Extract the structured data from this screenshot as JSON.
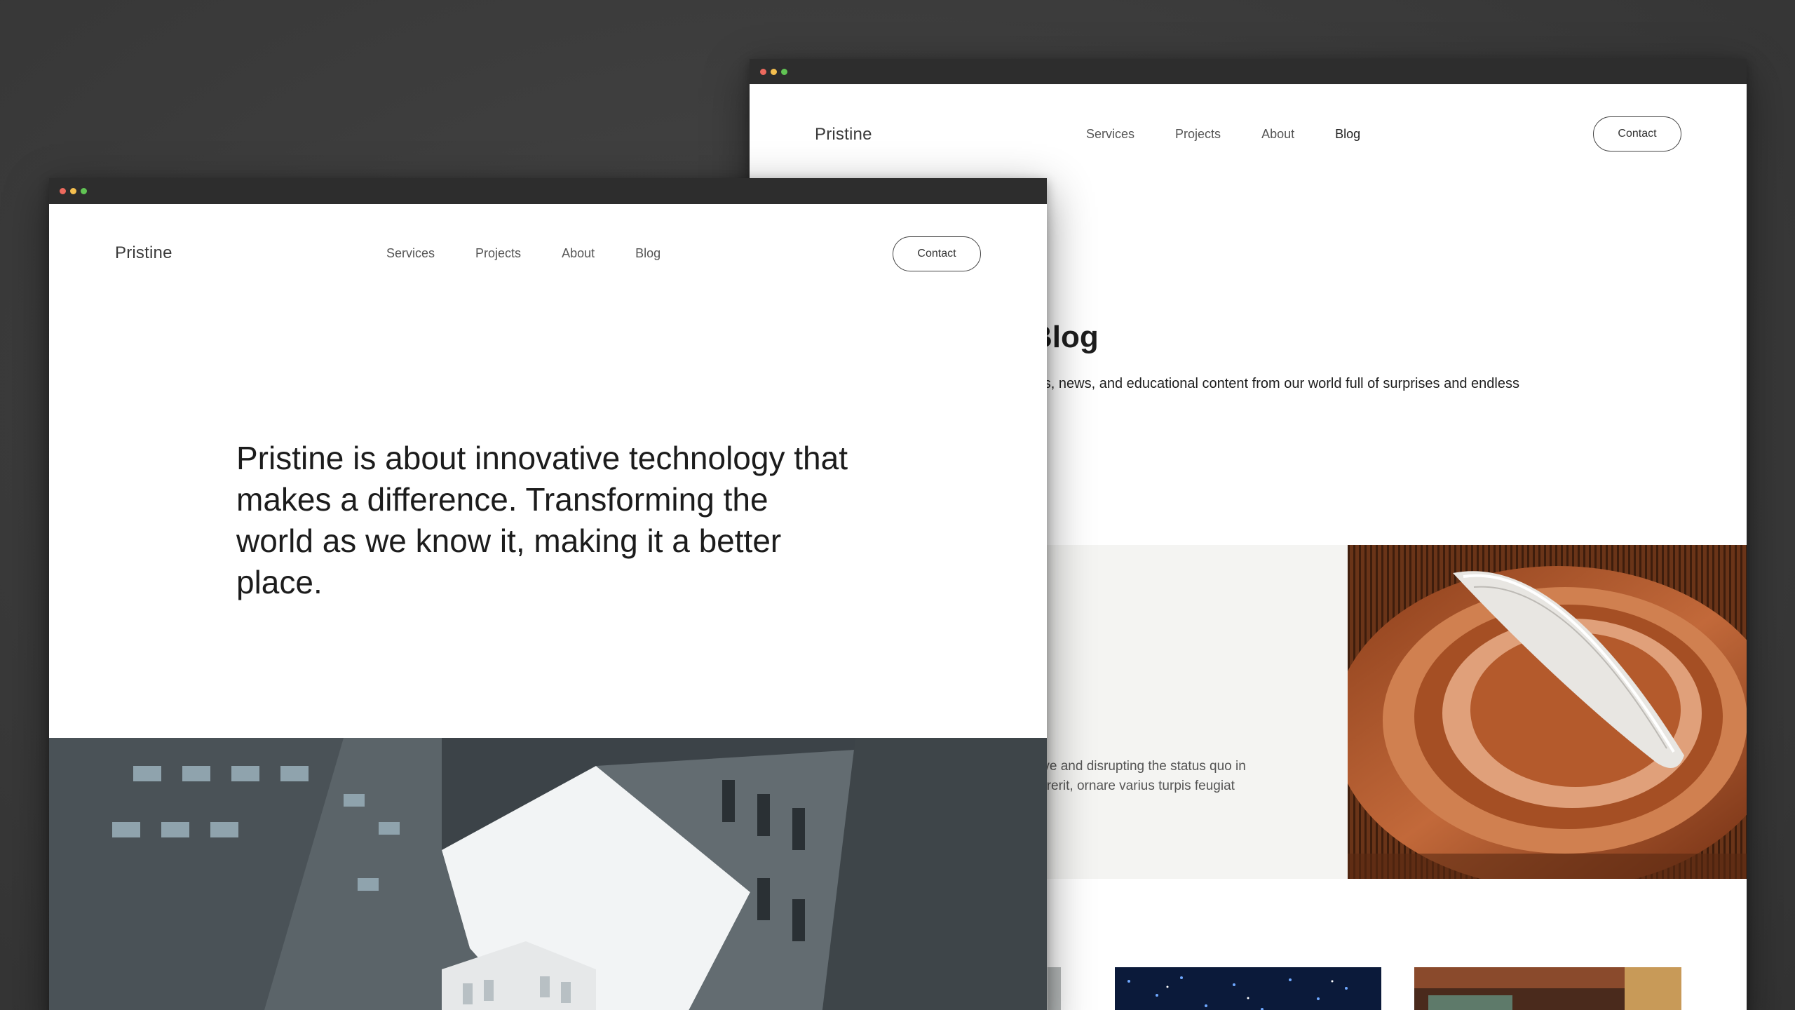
{
  "brand": "Pristine",
  "nav": {
    "links": [
      "Services",
      "Projects",
      "About",
      "Blog"
    ],
    "contact_label": "Contact"
  },
  "back_window": {
    "active_link": "Blog",
    "page_title": "Blog",
    "subtitle": "ates, news, and educational content from our world full of surprises and endless",
    "feature_lines": [
      "curve and disrupting the status quo in",
      "endrerit, ornare varius turpis feugiat"
    ]
  },
  "front_window": {
    "hero_text": "Pristine is about innovative technology that makes a difference. Transforming the world as we know it, making it a better place."
  },
  "colors": {
    "titlebar": "#2d2d2d",
    "traffic_red": "#ed6a5e",
    "traffic_yellow": "#f5bf4f",
    "traffic_green": "#61c454",
    "feature_bg": "#f4f4f2"
  }
}
